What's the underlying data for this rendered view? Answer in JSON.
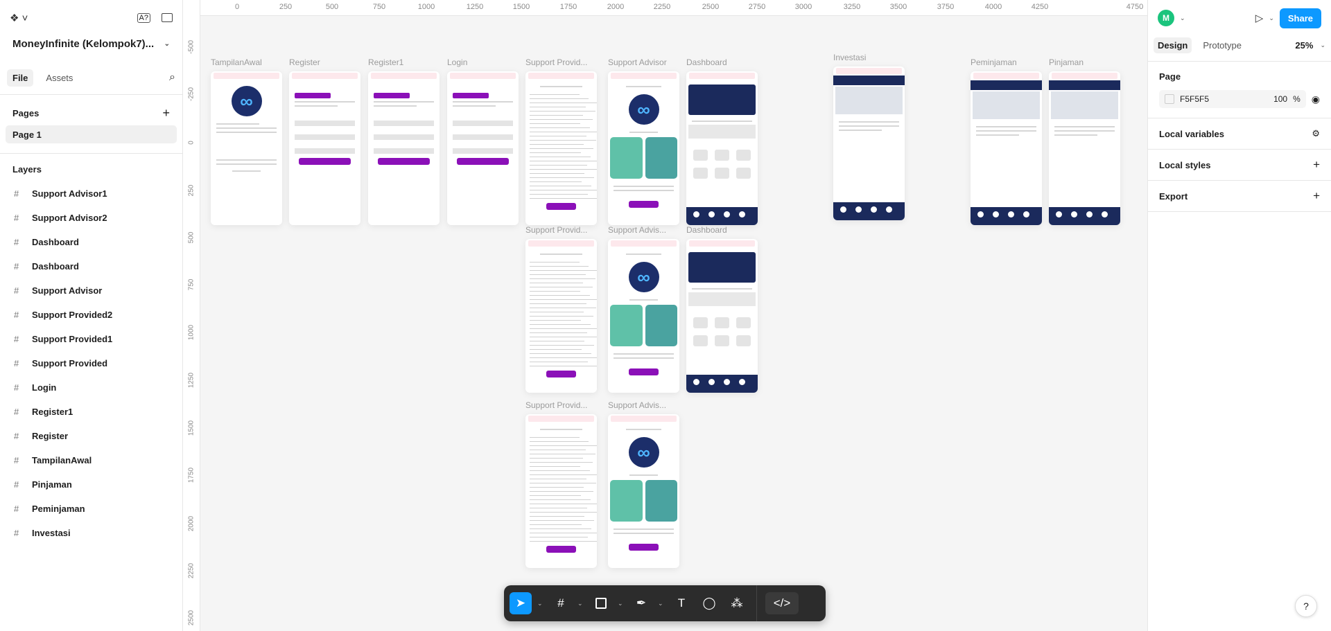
{
  "file": {
    "title": "MoneyInfinite (Kelompok7)...",
    "tabs": [
      "File",
      "Assets"
    ]
  },
  "pages": {
    "heading": "Pages",
    "items": [
      "Page 1"
    ]
  },
  "layers": {
    "heading": "Layers",
    "items": [
      "Support Advisor1",
      "Support Advisor2",
      "Dashboard",
      "Dashboard",
      "Support Advisor",
      "Support Provided2",
      "Support Provided1",
      "Support Provided",
      "Login",
      "Register1",
      "Register",
      "TampilanAwal",
      "Pinjaman",
      "Peminjaman",
      "Investasi"
    ]
  },
  "ruler": {
    "top": [
      "0",
      "250",
      "500",
      "750",
      "1000",
      "1250",
      "1500",
      "1750",
      "2000",
      "2250",
      "2500",
      "2750",
      "3000",
      "3250",
      "3500",
      "3750",
      "4000",
      "4250",
      "4750"
    ],
    "left": [
      "-500",
      "-250",
      "0",
      "250",
      "500",
      "750",
      "1000",
      "1250",
      "1500",
      "1750",
      "2000",
      "2250",
      "2500"
    ]
  },
  "frames": {
    "labels": [
      "TampilanAwal",
      "Register",
      "Register1",
      "Login",
      "Support Provid...",
      "Support Advisor",
      "Dashboard",
      "Investasi",
      "Peminjaman",
      "Pinjaman",
      "Support Provid...",
      "Support Advis...",
      "Dashboard",
      "Support Provid...",
      "Support Advis..."
    ]
  },
  "right": {
    "avatar": "M",
    "share": "Share",
    "tabs": [
      "Design",
      "Prototype"
    ],
    "zoom": "25%",
    "page_heading": "Page",
    "page_color": "F5F5F5",
    "page_opacity": "100",
    "percent": "%",
    "local_variables": "Local variables",
    "local_styles": "Local styles",
    "export": "Export"
  },
  "help": "?",
  "colors": {
    "accent": "#0d99ff",
    "brand": "#1b2a5c",
    "purple": "#8b10b8"
  }
}
